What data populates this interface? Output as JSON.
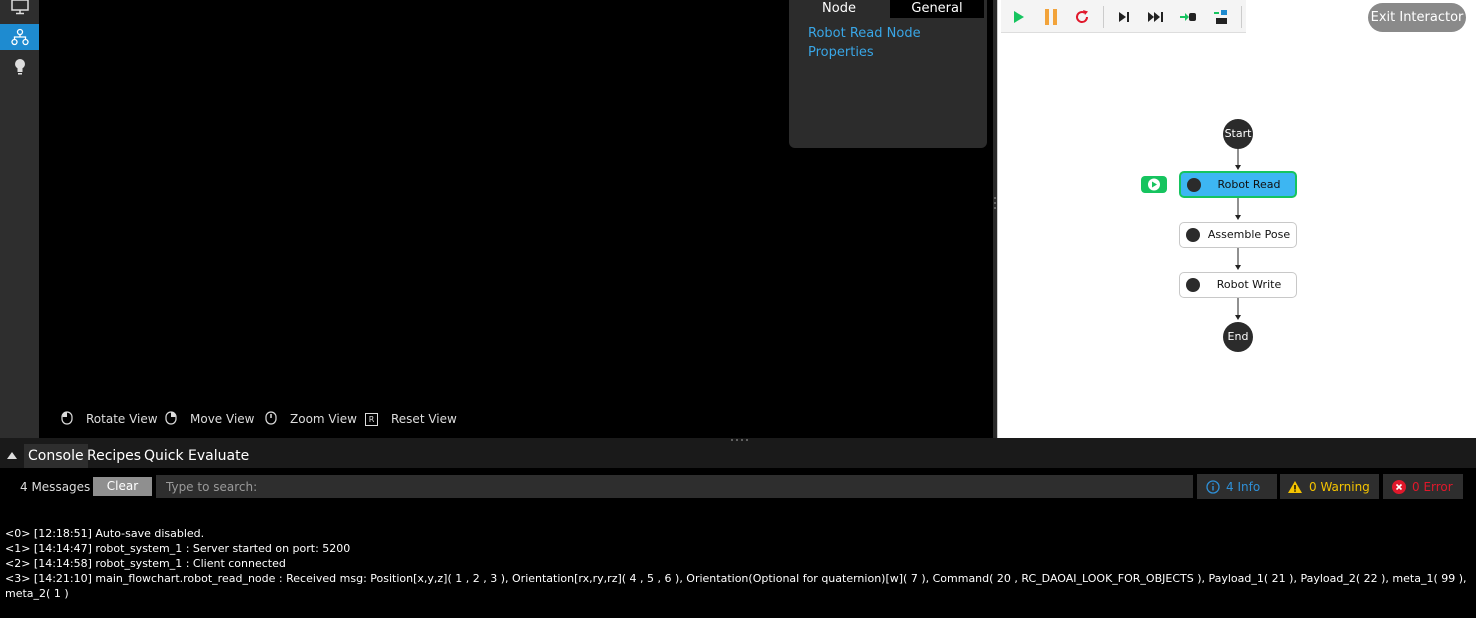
{
  "sidebar": {
    "items": [
      {
        "icon": "monitor-icon"
      },
      {
        "icon": "flowchart-icon"
      },
      {
        "icon": "lightbulb-icon"
      }
    ]
  },
  "node_panel": {
    "tabs": {
      "node": "Node",
      "general": "General"
    },
    "title": "Robot Read Node Properties"
  },
  "view_controls": {
    "rotate": "Rotate View",
    "move": "Move View",
    "zoom": "Zoom View",
    "reset": "Reset View",
    "reset_key": "R"
  },
  "toolbar": {
    "icons": [
      "play-icon",
      "pause-icon",
      "restart-icon",
      "step-icon",
      "fast-forward-icon",
      "step-into-icon",
      "step-over-icon"
    ],
    "exit_label": "Exit Interactor"
  },
  "flowchart": {
    "start": "Start",
    "nodes": [
      "Robot Read",
      "Assemble Pose",
      "Robot Write"
    ],
    "end": "End",
    "active_node": "Robot Read"
  },
  "bottom": {
    "tabs": [
      "Console",
      "Recipes",
      "Quick Evaluate"
    ],
    "message_count": "4 Messages",
    "clear_label": "Clear",
    "search_placeholder": "Type to search:",
    "filters": {
      "info": "4 Info",
      "warning": "0 Warning",
      "error": "0 Error"
    },
    "logs": [
      "<0> [12:18:51] Auto-save disabled.",
      "<1> [14:14:47] robot_system_1 : Server started on port: 5200",
      "<2> [14:14:58] robot_system_1 : Client connected",
      "<3> [14:21:10] main_flowchart.robot_read_node : Received msg: Position[x,y,z]( 1 , 2 , 3 ), Orientation[rx,ry,rz]( 4 , 5 , 6 ), Orientation(Optional for quaternion)[w]( 7 ), Command( 20 , RC_DAOAI_LOOK_FOR_OBJECTS ), Payload_1( 21 ), Payload_2( 22 ), meta_1( 99 ), meta_2( 1 )"
    ]
  },
  "colors": {
    "accent": "#1e8bd0",
    "link": "#39a6e6",
    "active_node": "#3db6f2",
    "running": "#16c45f",
    "warning": "#f5c400",
    "error": "#e0182b"
  }
}
